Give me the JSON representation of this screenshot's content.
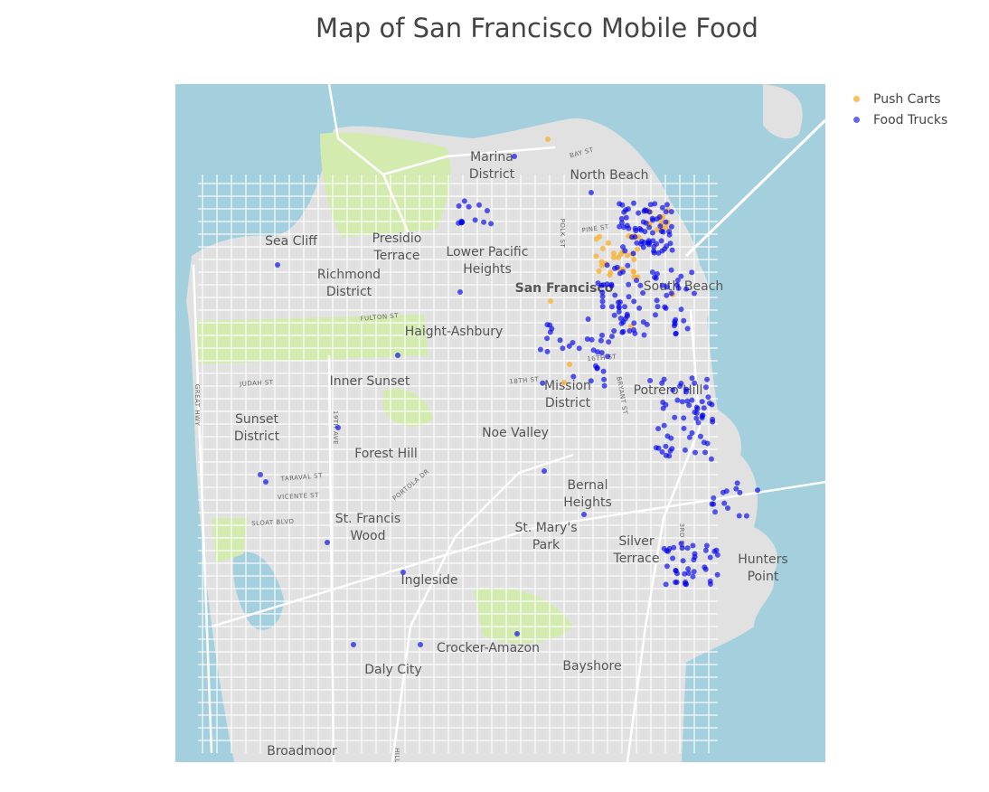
{
  "title": "Map of San Francisco Mobile Food",
  "legend": [
    {
      "label": "Push Carts",
      "color": "#f9b233"
    },
    {
      "label": "Food Trucks",
      "color": "#0000ee"
    }
  ],
  "map": {
    "neighborhoods": [
      "Marina District",
      "North Beach",
      "Presidio Terrace",
      "Sea Cliff",
      "Lower Pacific Heights",
      "Richmond District",
      "San Francisco",
      "South Beach",
      "Haight-Ashbury",
      "Inner Sunset",
      "Mission District",
      "Potrero Hill",
      "Sunset District",
      "Noe Valley",
      "Forest Hill",
      "Bernal Heights",
      "St. Francis Wood",
      "St. Mary's Park",
      "Silver Terrace",
      "Hunters Point",
      "Ingleside",
      "Crocker-Amazon",
      "Bayshore",
      "Daly City",
      "Broadmoor"
    ],
    "streets": [
      "BAY ST",
      "PINE ST",
      "POLK ST",
      "FULTON ST",
      "18TH ST",
      "16TH ST",
      "BRYANT ST",
      "JUDAH ST",
      "GREAT HWY",
      "19TH AVE",
      "TARAVAL ST",
      "VICENTE ST",
      "SLOAT BLVD",
      "PORTOLA DR",
      "3RD ST",
      "HILLS"
    ]
  }
}
